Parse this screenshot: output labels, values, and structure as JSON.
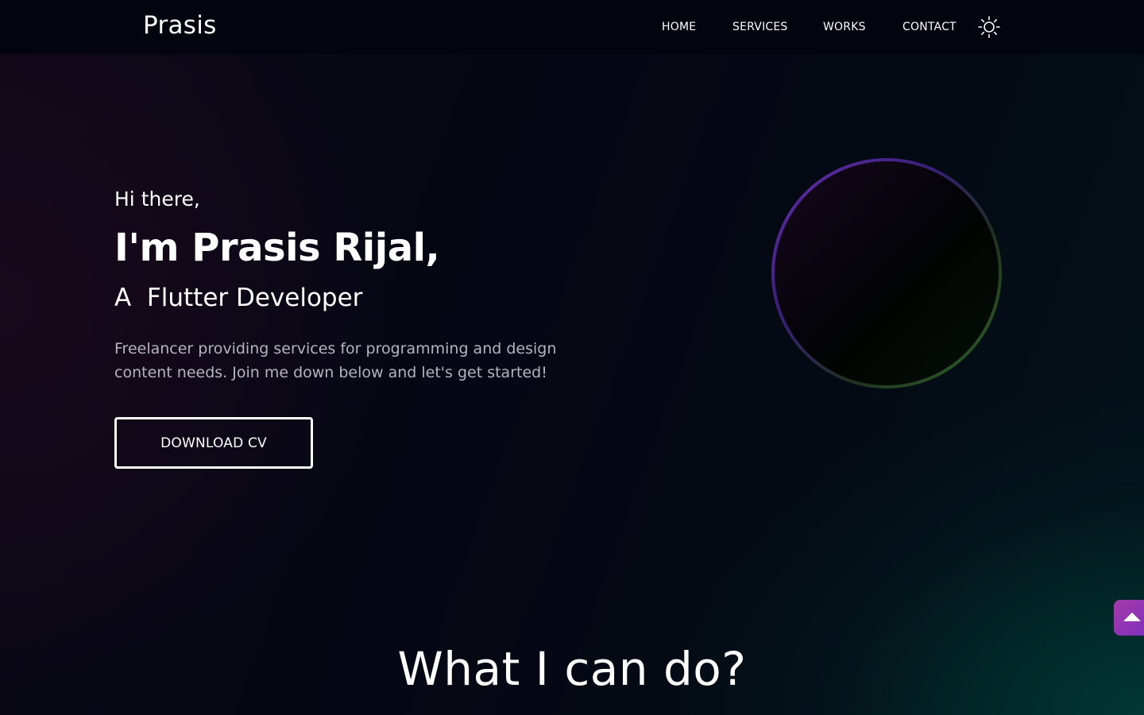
{
  "header": {
    "brand": "Prasis",
    "nav": {
      "home": "HOME",
      "services": "SERVICES",
      "works": "WORKS",
      "contact": "CONTACT"
    },
    "theme_toggle_icon": "sun-icon"
  },
  "hero": {
    "greeting": "Hi there,",
    "name": "I'm Prasis Rijal,",
    "role": "A  Flutter Developer",
    "description": "Freelancer providing services for programming and design content needs. Join me down below and let's get started!",
    "cta_label": "DOWNLOAD CV"
  },
  "services_section": {
    "title": "What I can do?"
  },
  "scroll_top": {
    "icon": "arrow-up-icon"
  },
  "colors": {
    "background": "#05060f",
    "text": "#ffffff",
    "muted_text": "#b4b4bc",
    "accent_purple": "#7a2fc0",
    "accent_magenta": "#a63aa8",
    "accent_green": "#2f6a2a",
    "glow_teal": "#004638"
  }
}
